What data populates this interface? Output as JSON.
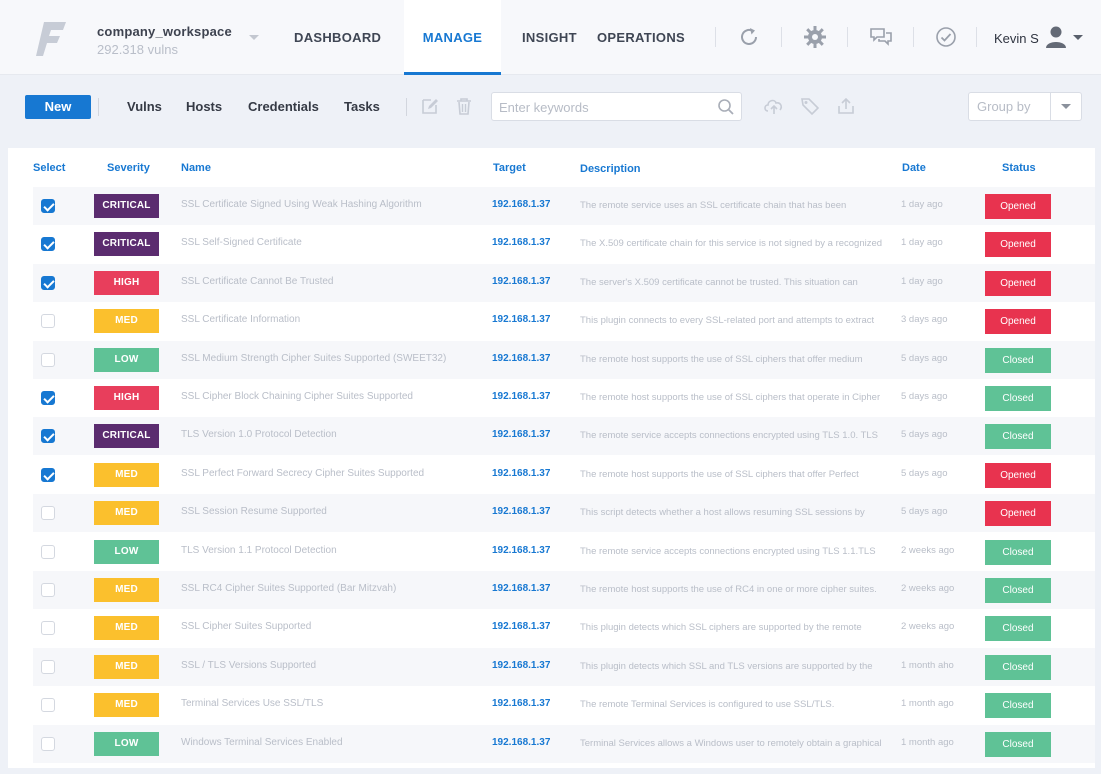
{
  "app": {
    "workspace_name": "company_workspace",
    "workspace_sub": "292.318 vulns"
  },
  "nav": {
    "tabs": [
      {
        "label": "DASHBOARD"
      },
      {
        "label": "MANAGE"
      },
      {
        "label": "INSIGHT"
      },
      {
        "label": "OPERATIONS"
      }
    ],
    "active_tab": "MANAGE"
  },
  "header_icons": [
    "refresh-icon",
    "gear-icon",
    "chat-icon",
    "check-circle-icon"
  ],
  "user": {
    "name": "Kevin S"
  },
  "toolbar": {
    "new_label": "New",
    "subtabs": [
      {
        "label": "Vulns"
      },
      {
        "label": "Hosts"
      },
      {
        "label": "Credentials"
      },
      {
        "label": "Tasks"
      }
    ],
    "search_placeholder": "Enter keywords",
    "groupby_placeholder": "Group by"
  },
  "table": {
    "headers": {
      "select": "Select",
      "severity": "Severity",
      "name": "Name",
      "target": "Target",
      "description": "Description",
      "date": "Date",
      "status": "Status"
    },
    "rows": [
      {
        "selected": true,
        "severity": "CRITICAL",
        "name": "SSL Certificate Signed Using Weak Hashing Algorithm",
        "target": "192.168.1.37",
        "description": "The remote service uses an SSL certificate chain that has been",
        "date": "1 day ago",
        "status": "Opened"
      },
      {
        "selected": true,
        "severity": "CRITICAL",
        "name": "SSL Self-Signed Certificate",
        "target": "192.168.1.37",
        "description": "The X.509 certificate chain for this service is not signed by a recognized",
        "date": "1 day ago",
        "status": "Opened"
      },
      {
        "selected": true,
        "severity": "HIGH",
        "name": "SSL Certificate Cannot Be Trusted",
        "target": "192.168.1.37",
        "description": "The server's X.509 certificate cannot be trusted. This situation can",
        "date": "1 day ago",
        "status": "Opened"
      },
      {
        "selected": false,
        "severity": "MED",
        "name": "SSL Certificate Information",
        "target": "192.168.1.37",
        "description": "This plugin connects to every SSL-related port and attempts to extract",
        "date": "3 days ago",
        "status": "Opened"
      },
      {
        "selected": false,
        "severity": "LOW",
        "name": "SSL Medium Strength Cipher Suites Supported (SWEET32)",
        "target": "192.168.1.37",
        "description": "The remote host supports the use of SSL ciphers that offer medium",
        "date": "5 days ago",
        "status": "Closed"
      },
      {
        "selected": true,
        "severity": "HIGH",
        "name": "SSL Cipher Block Chaining Cipher Suites Supported",
        "target": "192.168.1.37",
        "description": "The remote host supports the use of SSL ciphers that operate in Cipher",
        "date": "5 days ago",
        "status": "Closed"
      },
      {
        "selected": true,
        "severity": "CRITICAL",
        "name": "TLS Version 1.0 Protocol Detection",
        "target": "192.168.1.37",
        "description": "The remote service accepts connections encrypted using TLS 1.0. TLS",
        "date": "5 days ago",
        "status": "Closed"
      },
      {
        "selected": true,
        "severity": "MED",
        "name": "SSL Perfect Forward Secrecy Cipher Suites Supported",
        "target": "192.168.1.37",
        "description": "The remote host supports the use of SSL ciphers that offer Perfect",
        "date": "5 days ago",
        "status": "Opened"
      },
      {
        "selected": false,
        "severity": "MED",
        "name": "SSL Session Resume Supported",
        "target": "192.168.1.37",
        "description": "This script detects whether a host allows resuming SSL sessions by",
        "date": "5 days ago",
        "status": "Opened"
      },
      {
        "selected": false,
        "severity": "LOW",
        "name": "TLS Version 1.1 Protocol Detection",
        "target": "192.168.1.37",
        "description": "The remote service accepts connections encrypted using TLS 1.1.TLS",
        "date": "2 weeks ago",
        "status": "Closed"
      },
      {
        "selected": false,
        "severity": "MED",
        "name": "SSL RC4 Cipher Suites Supported (Bar Mitzvah)",
        "target": "192.168.1.37",
        "description": "The remote host supports the use of RC4 in one or more cipher suites.",
        "date": "2 weeks ago",
        "status": "Closed"
      },
      {
        "selected": false,
        "severity": "MED",
        "name": "SSL Cipher Suites Supported",
        "target": "192.168.1.37",
        "description": "This plugin detects which SSL ciphers are supported by the remote",
        "date": "2 weeks ago",
        "status": "Closed"
      },
      {
        "selected": false,
        "severity": "MED",
        "name": "SSL / TLS Versions Supported",
        "target": "192.168.1.37",
        "description": "This plugin detects which SSL and TLS versions are supported by the",
        "date": "1 month aho",
        "status": "Closed"
      },
      {
        "selected": false,
        "severity": "MED",
        "name": "Terminal Services Use SSL/TLS",
        "target": "192.168.1.37",
        "description": "The remote Terminal Services is configured to use SSL/TLS.",
        "date": "1 month ago",
        "status": "Closed"
      },
      {
        "selected": false,
        "severity": "LOW",
        "name": "Windows Terminal Services Enabled",
        "target": "192.168.1.37",
        "description": "Terminal Services allows a Windows user to remotely obtain a graphical",
        "date": "1 month ago",
        "status": "Closed"
      }
    ]
  },
  "colors": {
    "accent": "#1778d2",
    "severity": {
      "CRITICAL": "#5b2c6f",
      "HIGH": "#e83e5c",
      "MED": "#fbc02d",
      "LOW": "#5fc296"
    },
    "status": {
      "Opened": "#e8334f",
      "Closed": "#5fc296"
    }
  }
}
